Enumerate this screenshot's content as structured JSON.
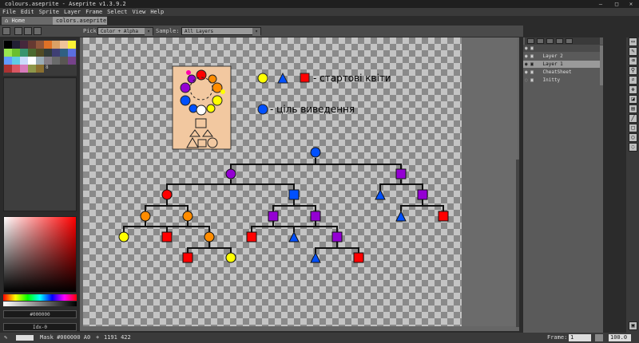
{
  "window": {
    "title": "colours.aseprite - Aseprite v1.3.9.2",
    "controls": [
      "–",
      "□",
      "✕"
    ]
  },
  "menu": [
    "File",
    "Edit",
    "Sprite",
    "Layer",
    "Frame",
    "Select",
    "View",
    "Help"
  ],
  "tabs": [
    {
      "label": "Home",
      "icon": "home-icon"
    },
    {
      "label": "colors.aseprite"
    }
  ],
  "context_bar": {
    "pick_label": "Pick:",
    "pick_value": "Color + Alpha",
    "sample_label": "Sample:",
    "sample_value": "All Layers"
  },
  "palette": {
    "colors": [
      "#000000",
      "#222034",
      "#45283c",
      "#663931",
      "#8f563b",
      "#df7126",
      "#d9a066",
      "#eec39a",
      "#fbf236",
      "#99e550",
      "#6abe30",
      "#37946e",
      "#4b692f",
      "#524b24",
      "#323c39",
      "#3f3f74",
      "#306082",
      "#5b6ee1",
      "#639bff",
      "#5fcde4",
      "#cbdbfc",
      "#ffffff",
      "#9badb7",
      "#847e87",
      "#696a6a",
      "#595652",
      "#76428a",
      "#ac3232",
      "#d95763",
      "#d77bba",
      "#8f974a",
      "#8a6f30"
    ],
    "last_label": "8"
  },
  "color_readouts": {
    "hex": "#000000",
    "index": "Idx-0"
  },
  "layers": [
    {
      "name": "Layer 2",
      "visible": true,
      "active": false
    },
    {
      "name": "Layer 1",
      "visible": true,
      "active": true
    },
    {
      "name": "CheatSheet",
      "visible": true,
      "active": false
    },
    {
      "name": "Initty",
      "visible": false,
      "active": false
    }
  ],
  "canvas": {
    "legend_start": "- стартові квіти",
    "legend_target": "- ціль виведення"
  },
  "status": {
    "mask": "Mask #000000 A0",
    "coords": "1191 422",
    "frame_label": "Frame:",
    "frame_value": "1",
    "zoom": "100.0"
  },
  "colors": {
    "yellow": "#ffff00",
    "red": "#ff0000",
    "orange": "#ff8c00",
    "purple": "#9400d3",
    "blue": "#0050ff",
    "sprite_bg": "#f2c8a0"
  }
}
